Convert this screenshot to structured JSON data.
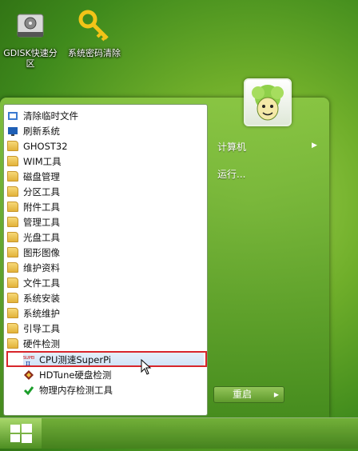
{
  "desktop": {
    "icons": [
      {
        "label": "GDISK快速分区"
      },
      {
        "label": "系统密码清除"
      }
    ]
  },
  "start_menu": {
    "items": [
      {
        "label": "清除临时文件",
        "icon": "broom-icon"
      },
      {
        "label": "刷新系统",
        "icon": "monitor-icon"
      },
      {
        "label": "GHOST32",
        "icon": "folder-icon"
      },
      {
        "label": "WIM工具",
        "icon": "folder-icon"
      },
      {
        "label": "磁盘管理",
        "icon": "folder-icon"
      },
      {
        "label": "分区工具",
        "icon": "folder-icon"
      },
      {
        "label": "附件工具",
        "icon": "folder-icon"
      },
      {
        "label": "管理工具",
        "icon": "folder-icon"
      },
      {
        "label": "光盘工具",
        "icon": "folder-icon"
      },
      {
        "label": "图形图像",
        "icon": "folder-icon"
      },
      {
        "label": "维护资料",
        "icon": "folder-icon"
      },
      {
        "label": "文件工具",
        "icon": "folder-icon"
      },
      {
        "label": "系统安装",
        "icon": "folder-icon"
      },
      {
        "label": "系统维护",
        "icon": "folder-icon"
      },
      {
        "label": "引导工具",
        "icon": "folder-icon"
      },
      {
        "label": "硬件检测",
        "icon": "folder-icon"
      }
    ],
    "sub_items": [
      {
        "label": "CPU测速SuperPi",
        "icon": "superpi-icon",
        "selected": true
      },
      {
        "label": "HDTune硬盘检测",
        "icon": "hdtune-icon"
      },
      {
        "label": "物理内存检测工具",
        "icon": "memtest-icon"
      }
    ],
    "right": {
      "computer": "计算机",
      "run": "运行..."
    },
    "restart_label": "重启"
  },
  "colors": {
    "highlight_border": "#d8262b",
    "accent": "#6fae2a"
  }
}
